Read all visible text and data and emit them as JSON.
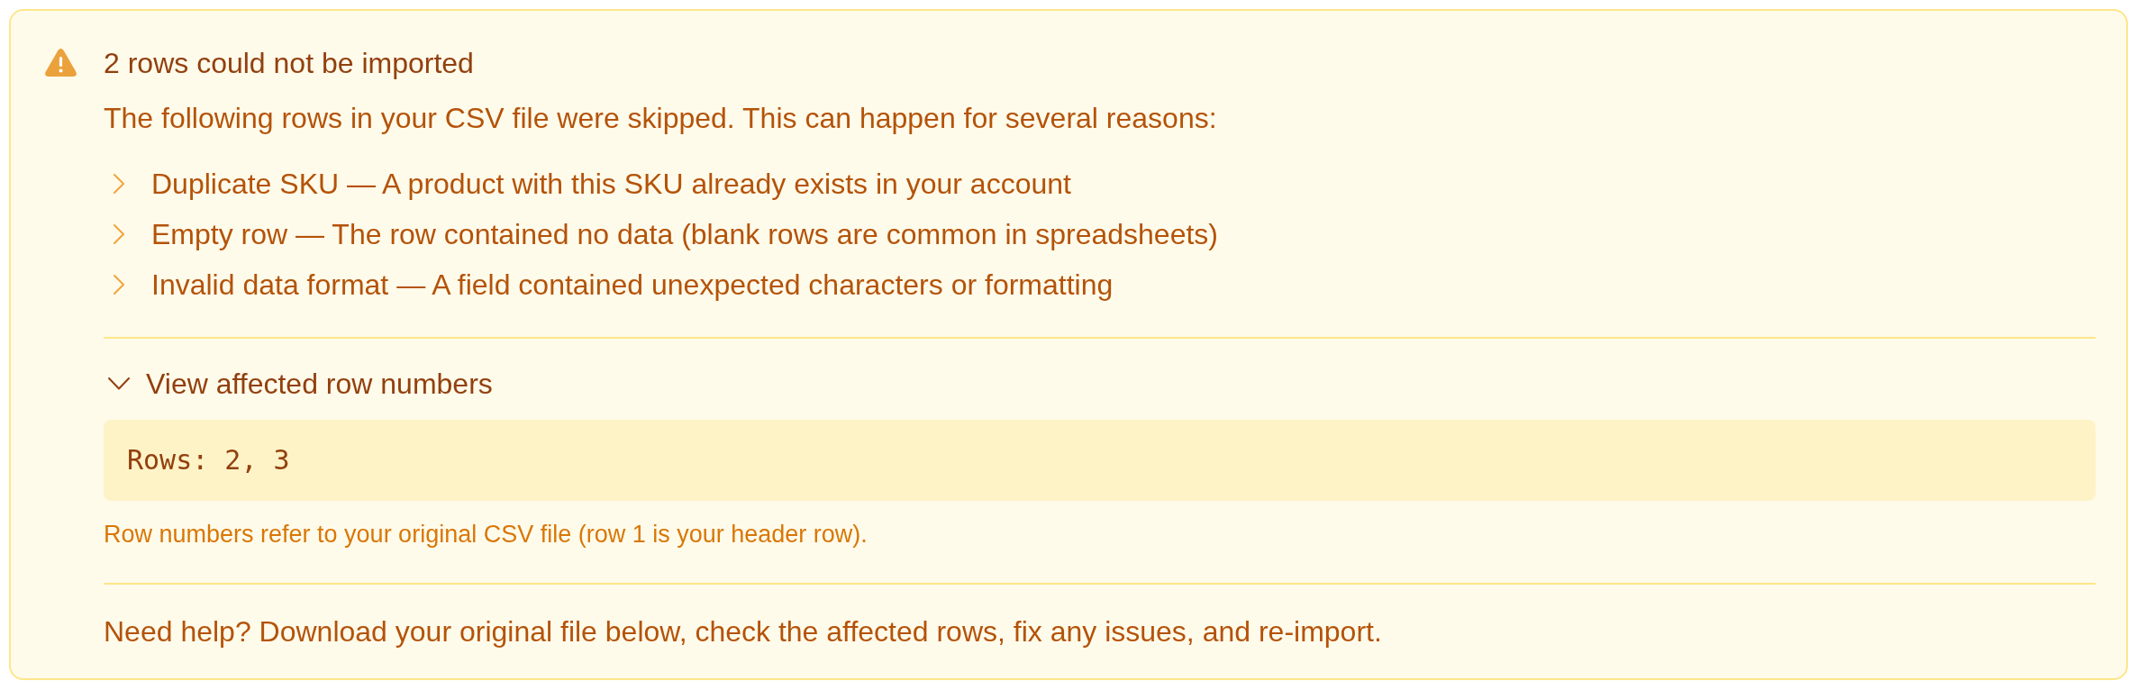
{
  "alert": {
    "title": "2 rows could not be imported",
    "description": "The following rows in your CSV file were skipped. This can happen for several reasons:",
    "reasons": [
      "Duplicate SKU — A product with this SKU already exists in your account",
      "Empty row — The row contained no data (blank rows are common in spreadsheets)",
      "Invalid data format — A field contained unexpected characters or formatting"
    ],
    "details": {
      "label": "View affected row numbers",
      "expanded": true,
      "rows": "Rows: 2, 3",
      "note": "Row numbers refer to your original CSV file (row 1 is your header row)."
    },
    "help": "Need help? Download your original file below, check the affected rows, fix any issues, and re-import."
  }
}
